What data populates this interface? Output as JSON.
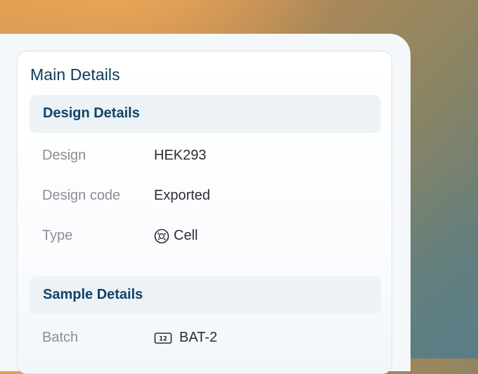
{
  "card": {
    "title": "Main Details"
  },
  "design_section": {
    "title": "Design Details",
    "rows": [
      {
        "label": "Design",
        "value": "HEK293",
        "icon": ""
      },
      {
        "label": "Design code",
        "value": "Exported",
        "icon": ""
      },
      {
        "label": "Type",
        "value": "Cell",
        "icon": "cell-icon"
      }
    ]
  },
  "sample_section": {
    "title": "Sample Details",
    "rows": [
      {
        "label": "Batch",
        "value": "BAT-2",
        "icon": "batch-number-icon"
      }
    ]
  },
  "colors": {
    "title": "#0f3a5a",
    "section_title": "#0d4568",
    "section_bg": "#edf2f6",
    "label": "#8a8f96",
    "value": "#2a2f35"
  }
}
